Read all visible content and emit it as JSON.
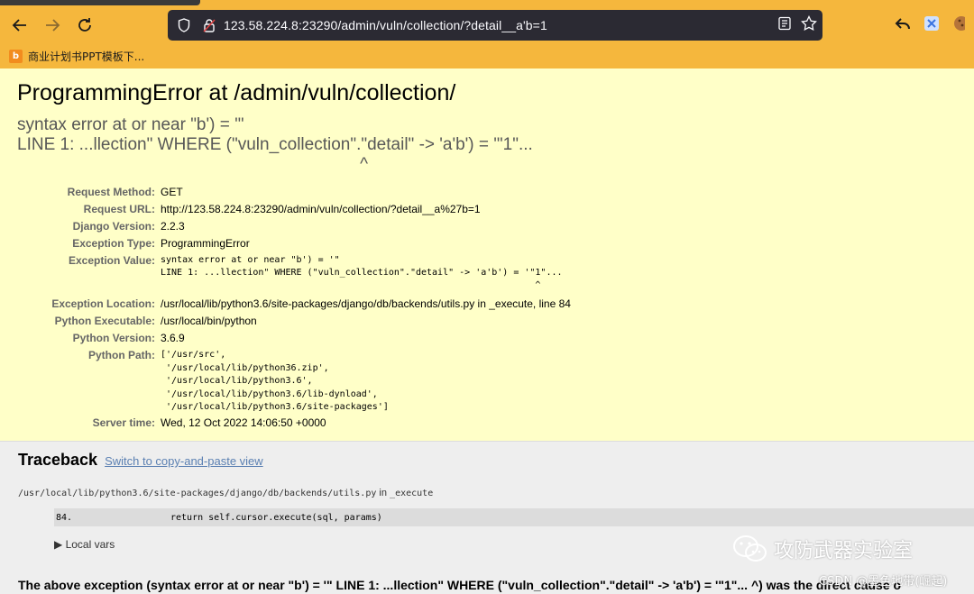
{
  "browser": {
    "url": "123.58.224.8:23290/admin/vuln/collection/?detail__a'b=1",
    "bookmark_label": "商业计划书PPT模板下...",
    "bookmark_icon": "b"
  },
  "error": {
    "title": "ProgrammingError at /admin/vuln/collection/",
    "value": "syntax error at or near \"b') = '\"\nLINE 1: ...llection\" WHERE (\"vuln_collection\".\"detail\" -> 'a'b') = '\"1\"...\n                                                                        ^"
  },
  "meta": [
    {
      "label": "Request Method:",
      "value": "GET"
    },
    {
      "label": "Request URL:",
      "value": "http://123.58.224.8:23290/admin/vuln/collection/?detail__a%27b=1"
    },
    {
      "label": "Django Version:",
      "value": "2.2.3"
    },
    {
      "label": "Exception Type:",
      "value": "ProgrammingError"
    },
    {
      "label": "Exception Value:",
      "value": "syntax error at or near \"b') = '\"\nLINE 1: ...llection\" WHERE (\"vuln_collection\".\"detail\" -> 'a'b') = '\"1\"...\n                                                                     ^"
    },
    {
      "label": "Exception Location:",
      "value": "/usr/local/lib/python3.6/site-packages/django/db/backends/utils.py in _execute, line 84"
    },
    {
      "label": "Python Executable:",
      "value": "/usr/local/bin/python"
    },
    {
      "label": "Python Version:",
      "value": "3.6.9"
    },
    {
      "label": "Python Path:",
      "value": "['/usr/src',\n '/usr/local/lib/python36.zip',\n '/usr/local/lib/python3.6',\n '/usr/local/lib/python3.6/lib-dynload',\n '/usr/local/lib/python3.6/site-packages']"
    },
    {
      "label": "Server time:",
      "value": "Wed, 12 Oct 2022 14:06:50 +0000"
    }
  ],
  "traceback": {
    "heading": "Traceback",
    "switch_link": "Switch to copy-and-paste view",
    "frame_file": "/usr/local/lib/python3.6/site-packages/django/db/backends/utils.py",
    "frame_in": " in ",
    "frame_func": "_execute",
    "line_no": "84.",
    "line_code": "return self.cursor.execute(sql, params)",
    "local_vars": "▶ Local vars",
    "above_exception": "The above exception (syntax error at or near \"b') = '\" LINE 1: ...llection\" WHERE (\"vuln_collection\".\"detail\" -> 'a'b') = '\"1\"... ^) was the direct cause o"
  },
  "watermark": {
    "text": "攻防武器实验室",
    "csdn": "CSDN @墨色地带(崛起)"
  },
  "colors": {
    "chrome": "#f5b73d",
    "summary_bg": "#ffffc8",
    "traceback_bg": "#eeeeee",
    "link": "#5b80b2"
  }
}
